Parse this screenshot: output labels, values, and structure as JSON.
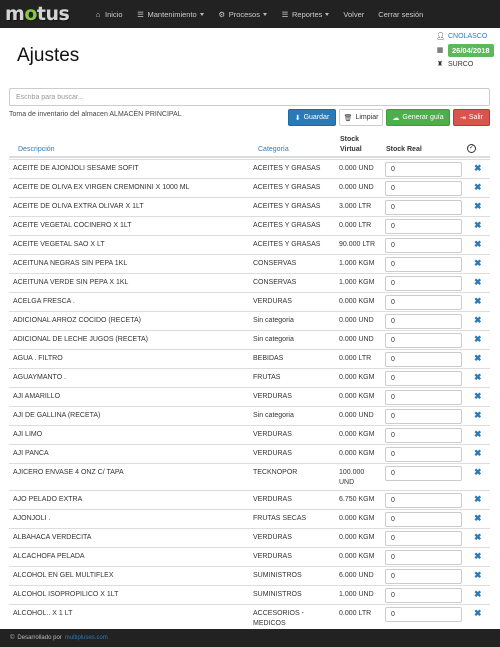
{
  "nav": {
    "logo": "motus",
    "items": [
      {
        "label": "Inicio",
        "icon": "home-icon",
        "glyph": "⌂",
        "dropdown": false
      },
      {
        "label": "Mantenimiento",
        "icon": "list-icon",
        "glyph": "☰",
        "dropdown": true
      },
      {
        "label": "Procesos",
        "icon": "gear-icon",
        "glyph": "⚙",
        "dropdown": true
      },
      {
        "label": "Reportes",
        "icon": "list-icon",
        "glyph": "☰",
        "dropdown": true
      },
      {
        "label": "Volver",
        "icon": "",
        "glyph": "",
        "dropdown": false
      },
      {
        "label": "Cerrar sesión",
        "icon": "",
        "glyph": "",
        "dropdown": false
      }
    ]
  },
  "header": {
    "title": "Ajustes",
    "user": "CNOLASCO",
    "date": "26/04/2018",
    "store": "SURCO"
  },
  "search": {
    "placeholder": "Escriba para buscar..."
  },
  "note": "Toma de inventario del almacen ALMACÉN PRINCIPAL",
  "buttons": {
    "guardar": "Guardar",
    "limpiar": "Limpiar",
    "guia": "Generar guía",
    "salir": "Salir"
  },
  "table": {
    "headers": {
      "descripcion": "Descripción",
      "categoria": "Categoría",
      "stock_line1": "Stock",
      "stock_line2": "Virtual",
      "real": "Stock Real"
    },
    "rows": [
      {
        "desc": "ACEITE DE AJONJOLI SESAME SOFIT",
        "cat": "ACEITES Y GRASAS",
        "stock": "0.000 UND",
        "real": "0"
      },
      {
        "desc": "ACEITE DE OLIVA EX VIRGEN CREMONINI X 1000 ML",
        "cat": "ACEITES Y GRASAS",
        "stock": "0.000 UND",
        "real": "0"
      },
      {
        "desc": "ACEITE DE OLIVA EXTRA OLIVAR X 1LT",
        "cat": "ACEITES Y GRASAS",
        "stock": "3.000 LTR",
        "real": "0"
      },
      {
        "desc": "ACEITE VEGETAL COCINERO X 1LT",
        "cat": "ACEITES Y GRASAS",
        "stock": "0.000 LTR",
        "real": "0"
      },
      {
        "desc": "ACEITE VEGETAL SAO X LT",
        "cat": "ACEITES Y GRASAS",
        "stock": "90.000 LTR",
        "real": "0"
      },
      {
        "desc": "ACEITUNA NEGRAS SIN PEPA 1KL",
        "cat": "CONSERVAS",
        "stock": "1.000 KGM",
        "real": "0"
      },
      {
        "desc": "ACEITUNA VERDE SIN PEPA X 1KL",
        "cat": "CONSERVAS",
        "stock": "1.000 KGM",
        "real": "0"
      },
      {
        "desc": "ACELGA FRESCA .",
        "cat": "VERDURAS",
        "stock": "0.000 KGM",
        "real": "0"
      },
      {
        "desc": "ADICIONAL ARROZ COCIDO (RECETA)",
        "cat": "Sin categoria",
        "stock": "0.000 UND",
        "real": "0"
      },
      {
        "desc": "ADICIONAL DE LECHE JUGOS (RECETA)",
        "cat": "Sin categoria",
        "stock": "0.000 UND",
        "real": "0"
      },
      {
        "desc": "AGUA . FILTRO",
        "cat": "BEBIDAS",
        "stock": "0.000 LTR",
        "real": "0"
      },
      {
        "desc": "AGUAYMANTO .",
        "cat": "FRUTAS",
        "stock": "0.000 KGM",
        "real": "0"
      },
      {
        "desc": "AJI AMARILLO",
        "cat": "VERDURAS",
        "stock": "0.000 KGM",
        "real": "0"
      },
      {
        "desc": "AJI DE GALLINA (RECETA)",
        "cat": "Sin categoria",
        "stock": "0.000 UND",
        "real": "0"
      },
      {
        "desc": "AJI LIMO",
        "cat": "VERDURAS",
        "stock": "0.000 KGM",
        "real": "0"
      },
      {
        "desc": "AJI PANCA",
        "cat": "VERDURAS",
        "stock": "0.000 KGM",
        "real": "0"
      },
      {
        "desc": "AJICERO ENVASE 4 ONZ C/ TAPA",
        "cat": "TECKNOPOR",
        "stock": "100.000 UND",
        "real": "0",
        "tall": true
      },
      {
        "desc": "AJO PELADO EXTRA",
        "cat": "VERDURAS",
        "stock": "6.750 KGM",
        "real": "0"
      },
      {
        "desc": "AJONJOLI .",
        "cat": "FRUTAS SECAS",
        "stock": "0.000 KGM",
        "real": "0"
      },
      {
        "desc": "ALBAHACA VERDECITA",
        "cat": "VERDURAS",
        "stock": "0.000 KGM",
        "real": "0"
      },
      {
        "desc": "ALCACHOFA PELADA",
        "cat": "VERDURAS",
        "stock": "0.000 KGM",
        "real": "0"
      },
      {
        "desc": "ALCOHOL EN GEL MULTIFLEX",
        "cat": "SUMINISTROS",
        "stock": "6.000 UND",
        "real": "0"
      },
      {
        "desc": "ALCOHOL ISOPROPILICO X 1LT",
        "cat": "SUMINISTROS",
        "stock": "1.000 UND",
        "real": "0"
      },
      {
        "desc": "ALCOHOL.. X 1 LT",
        "cat": "ACCESORIOS - MEDICOS",
        "stock": "0.000 LTR",
        "real": "0",
        "tall": true
      }
    ]
  },
  "footer": {
    "text": "Desarrollado por",
    "link": "multipluses.com"
  }
}
